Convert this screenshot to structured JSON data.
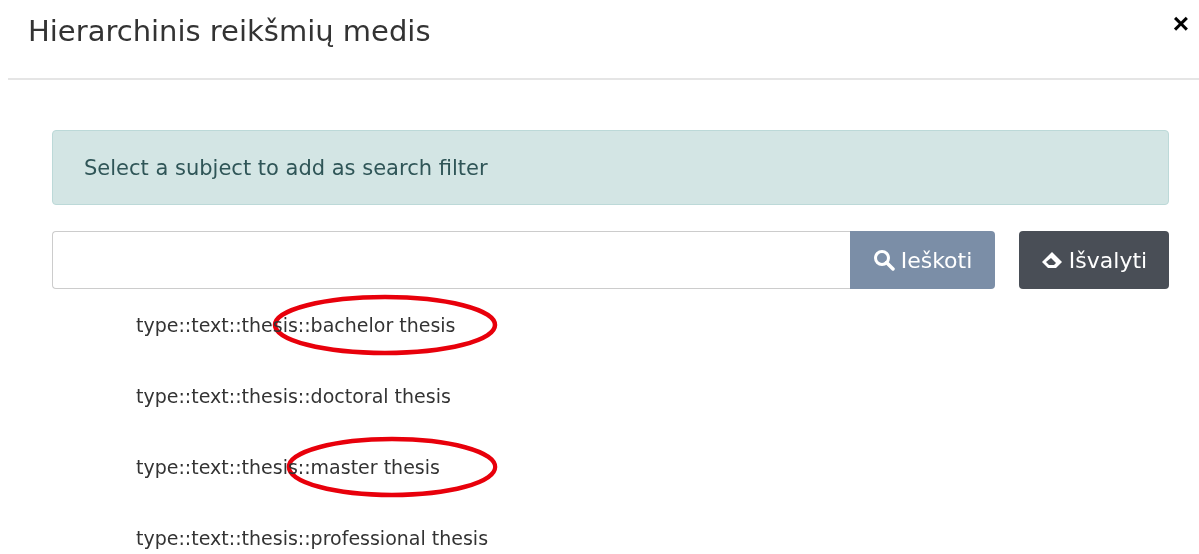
{
  "dialog": {
    "title": "Hierarchinis reikšmių medis",
    "close": "×"
  },
  "alert": {
    "text": "Select a subject to add as search filter"
  },
  "search": {
    "search_button": "Ieškoti",
    "clear_button": "Išvalyti"
  },
  "subjects": [
    {
      "label": "type::text::thesis::bachelor thesis",
      "circled": true
    },
    {
      "label": "type::text::thesis::doctoral thesis",
      "circled": false
    },
    {
      "label": "type::text::thesis::master thesis",
      "circled": true
    },
    {
      "label": "type::text::thesis::professional thesis",
      "circled": false
    }
  ]
}
